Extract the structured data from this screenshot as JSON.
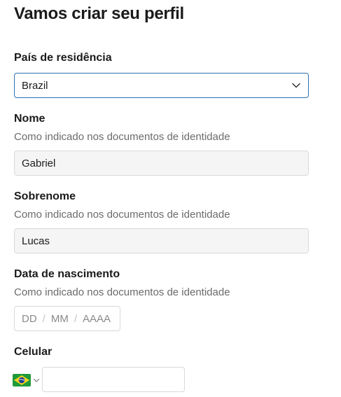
{
  "page": {
    "title": "Vamos criar seu perfil"
  },
  "country": {
    "label": "País de residência",
    "selected": "Brazil"
  },
  "first_name": {
    "label": "Nome",
    "hint": "Como indicado nos documentos de identidade",
    "value": "Gabriel"
  },
  "last_name": {
    "label": "Sobrenome",
    "hint": "Como indicado nos documentos de identidade",
    "value": "Lucas"
  },
  "birthdate": {
    "label": "Data de nascimento",
    "hint": "Como indicado nos documentos de identidade",
    "day_placeholder": "DD",
    "month_placeholder": "MM",
    "year_placeholder": "AAAA",
    "separator": "/"
  },
  "phone": {
    "label": "Celular",
    "country_flag_icon": "brazil-flag-icon",
    "value": ""
  },
  "colors": {
    "focus_border": "#2f6fb3",
    "field_background": "#f5f5f5",
    "hint_text": "#6b6b6b"
  }
}
